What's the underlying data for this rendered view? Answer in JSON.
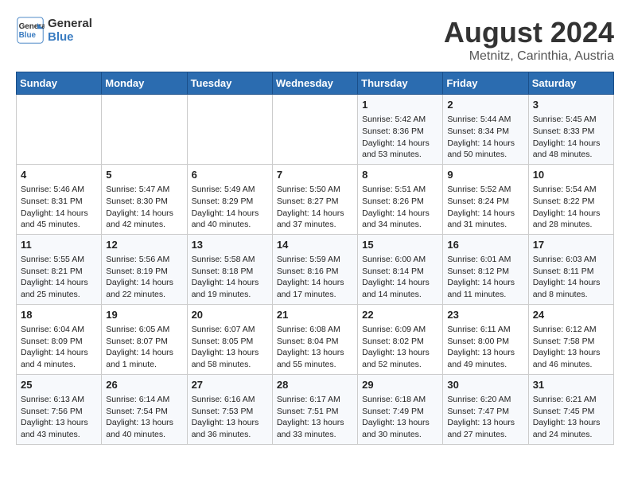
{
  "header": {
    "logo_line1": "General",
    "logo_line2": "Blue",
    "title": "August 2024",
    "subtitle": "Metnitz, Carinthia, Austria"
  },
  "days_of_week": [
    "Sunday",
    "Monday",
    "Tuesday",
    "Wednesday",
    "Thursday",
    "Friday",
    "Saturday"
  ],
  "weeks": [
    [
      {
        "day": "",
        "content": ""
      },
      {
        "day": "",
        "content": ""
      },
      {
        "day": "",
        "content": ""
      },
      {
        "day": "",
        "content": ""
      },
      {
        "day": "1",
        "content": "Sunrise: 5:42 AM\nSunset: 8:36 PM\nDaylight: 14 hours\nand 53 minutes."
      },
      {
        "day": "2",
        "content": "Sunrise: 5:44 AM\nSunset: 8:34 PM\nDaylight: 14 hours\nand 50 minutes."
      },
      {
        "day": "3",
        "content": "Sunrise: 5:45 AM\nSunset: 8:33 PM\nDaylight: 14 hours\nand 48 minutes."
      }
    ],
    [
      {
        "day": "4",
        "content": "Sunrise: 5:46 AM\nSunset: 8:31 PM\nDaylight: 14 hours\nand 45 minutes."
      },
      {
        "day": "5",
        "content": "Sunrise: 5:47 AM\nSunset: 8:30 PM\nDaylight: 14 hours\nand 42 minutes."
      },
      {
        "day": "6",
        "content": "Sunrise: 5:49 AM\nSunset: 8:29 PM\nDaylight: 14 hours\nand 40 minutes."
      },
      {
        "day": "7",
        "content": "Sunrise: 5:50 AM\nSunset: 8:27 PM\nDaylight: 14 hours\nand 37 minutes."
      },
      {
        "day": "8",
        "content": "Sunrise: 5:51 AM\nSunset: 8:26 PM\nDaylight: 14 hours\nand 34 minutes."
      },
      {
        "day": "9",
        "content": "Sunrise: 5:52 AM\nSunset: 8:24 PM\nDaylight: 14 hours\nand 31 minutes."
      },
      {
        "day": "10",
        "content": "Sunrise: 5:54 AM\nSunset: 8:22 PM\nDaylight: 14 hours\nand 28 minutes."
      }
    ],
    [
      {
        "day": "11",
        "content": "Sunrise: 5:55 AM\nSunset: 8:21 PM\nDaylight: 14 hours\nand 25 minutes."
      },
      {
        "day": "12",
        "content": "Sunrise: 5:56 AM\nSunset: 8:19 PM\nDaylight: 14 hours\nand 22 minutes."
      },
      {
        "day": "13",
        "content": "Sunrise: 5:58 AM\nSunset: 8:18 PM\nDaylight: 14 hours\nand 19 minutes."
      },
      {
        "day": "14",
        "content": "Sunrise: 5:59 AM\nSunset: 8:16 PM\nDaylight: 14 hours\nand 17 minutes."
      },
      {
        "day": "15",
        "content": "Sunrise: 6:00 AM\nSunset: 8:14 PM\nDaylight: 14 hours\nand 14 minutes."
      },
      {
        "day": "16",
        "content": "Sunrise: 6:01 AM\nSunset: 8:12 PM\nDaylight: 14 hours\nand 11 minutes."
      },
      {
        "day": "17",
        "content": "Sunrise: 6:03 AM\nSunset: 8:11 PM\nDaylight: 14 hours\nand 8 minutes."
      }
    ],
    [
      {
        "day": "18",
        "content": "Sunrise: 6:04 AM\nSunset: 8:09 PM\nDaylight: 14 hours\nand 4 minutes."
      },
      {
        "day": "19",
        "content": "Sunrise: 6:05 AM\nSunset: 8:07 PM\nDaylight: 14 hours\nand 1 minute."
      },
      {
        "day": "20",
        "content": "Sunrise: 6:07 AM\nSunset: 8:05 PM\nDaylight: 13 hours\nand 58 minutes."
      },
      {
        "day": "21",
        "content": "Sunrise: 6:08 AM\nSunset: 8:04 PM\nDaylight: 13 hours\nand 55 minutes."
      },
      {
        "day": "22",
        "content": "Sunrise: 6:09 AM\nSunset: 8:02 PM\nDaylight: 13 hours\nand 52 minutes."
      },
      {
        "day": "23",
        "content": "Sunrise: 6:11 AM\nSunset: 8:00 PM\nDaylight: 13 hours\nand 49 minutes."
      },
      {
        "day": "24",
        "content": "Sunrise: 6:12 AM\nSunset: 7:58 PM\nDaylight: 13 hours\nand 46 minutes."
      }
    ],
    [
      {
        "day": "25",
        "content": "Sunrise: 6:13 AM\nSunset: 7:56 PM\nDaylight: 13 hours\nand 43 minutes."
      },
      {
        "day": "26",
        "content": "Sunrise: 6:14 AM\nSunset: 7:54 PM\nDaylight: 13 hours\nand 40 minutes."
      },
      {
        "day": "27",
        "content": "Sunrise: 6:16 AM\nSunset: 7:53 PM\nDaylight: 13 hours\nand 36 minutes."
      },
      {
        "day": "28",
        "content": "Sunrise: 6:17 AM\nSunset: 7:51 PM\nDaylight: 13 hours\nand 33 minutes."
      },
      {
        "day": "29",
        "content": "Sunrise: 6:18 AM\nSunset: 7:49 PM\nDaylight: 13 hours\nand 30 minutes."
      },
      {
        "day": "30",
        "content": "Sunrise: 6:20 AM\nSunset: 7:47 PM\nDaylight: 13 hours\nand 27 minutes."
      },
      {
        "day": "31",
        "content": "Sunrise: 6:21 AM\nSunset: 7:45 PM\nDaylight: 13 hours\nand 24 minutes."
      }
    ]
  ]
}
